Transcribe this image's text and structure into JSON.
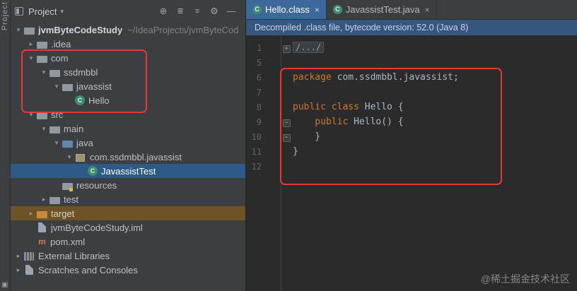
{
  "activity_bar": {
    "label": "Project"
  },
  "icons": {
    "class_glyph": "C",
    "maven_glyph": "m",
    "close": "×",
    "caret_down": "▾",
    "chevron_down": "▾",
    "chevron_right": "▸",
    "locate": "⊕",
    "collapse_all": "≣",
    "expand_all": "≡",
    "settings": "⚙",
    "hide": "—",
    "tool_window": "▣",
    "fold_collapsed": "+",
    "fold_expanded": "−"
  },
  "project_panel": {
    "title": "Project",
    "tree": [
      {
        "label": "jvmByteCodeStudy",
        "path": "~/IdeaProjects/jvmByteCod"
      },
      {
        "label": ".idea"
      },
      {
        "label": "com"
      },
      {
        "label": "ssdmbbl"
      },
      {
        "label": "javassist"
      },
      {
        "label": "Hello"
      },
      {
        "label": "src"
      },
      {
        "label": "main"
      },
      {
        "label": "java"
      },
      {
        "label": "com.ssdmbbl.javassist"
      },
      {
        "label": "JavassistTest"
      },
      {
        "label": "resources"
      },
      {
        "label": "test"
      },
      {
        "label": "target"
      },
      {
        "label": "jvmByteCodeStudy.iml"
      },
      {
        "label": "pom.xml"
      },
      {
        "label": "External Libraries"
      },
      {
        "label": "Scratches and Consoles"
      }
    ]
  },
  "editor": {
    "tabs": [
      {
        "label": "Hello.class"
      },
      {
        "label": "JavassistTest.java"
      }
    ],
    "notification": "Decompiled .class file, bytecode version: 52.0 (Java 8)",
    "code": {
      "lines": [
        {
          "num": "1",
          "chip": "/.../"
        },
        {
          "num": "5"
        },
        {
          "num": "6",
          "kw": "package ",
          "rest": "com.ssdmbbl.javassist;"
        },
        {
          "num": "7"
        },
        {
          "num": "8",
          "kw": "public class ",
          "rest": "Hello {"
        },
        {
          "num": "9",
          "kw": "    public ",
          "rest": "Hello() {"
        },
        {
          "num": "10",
          "rest": "    }"
        },
        {
          "num": "11",
          "rest": "}"
        },
        {
          "num": "12"
        }
      ]
    }
  },
  "watermark": "@稀土掘金技术社区",
  "colors": {
    "annotation_red": "#e53935",
    "selection_blue": "#2e5a87",
    "target_highlight": "#6e5327",
    "keyword_orange": "#cc7832",
    "banner_blue": "#37567e",
    "active_tab_blue": "#3d689b"
  }
}
